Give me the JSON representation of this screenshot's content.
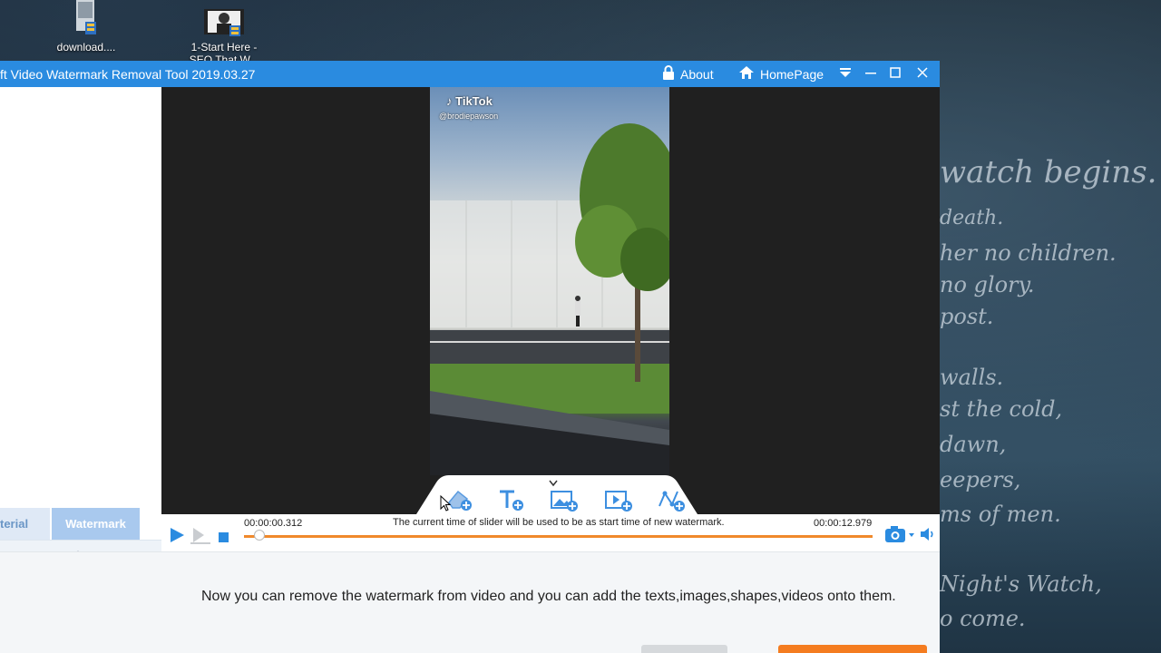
{
  "desktop": {
    "icons": [
      {
        "label": "download...."
      },
      {
        "label": "1-Start Here -",
        "label2": "SEO That W..."
      }
    ],
    "poem_lines": [
      "watch begins.",
      "death.",
      "her no children.",
      "no glory.",
      "post.",
      "walls.",
      "st the cold,",
      "dawn,",
      "eepers,",
      "ms of men.",
      "Night's Watch,",
      "o come."
    ]
  },
  "window": {
    "title": "ft Video Watermark Removal Tool 2019.03.27",
    "about_label": "About",
    "homepage_label": "HomePage"
  },
  "left_panel": {
    "tabs": [
      {
        "label": "terial"
      },
      {
        "label": "Watermark"
      }
    ]
  },
  "video": {
    "tiktok_brand": "TikTok",
    "tiktok_user": "@brodiepawson"
  },
  "player": {
    "current_time": "00:00:00.312",
    "total_time": "00:00:12.979",
    "hint": "The current time of slider will be used to be as start time of new watermark.",
    "progress": 0.024
  },
  "bottom": {
    "message": "Now you can remove the watermark from video and you can add the texts,images,shapes,videos onto them."
  },
  "colors": {
    "titlebar": "#2a8be0",
    "accent_orange": "#f0892b",
    "play_blue": "#2a8be0"
  }
}
